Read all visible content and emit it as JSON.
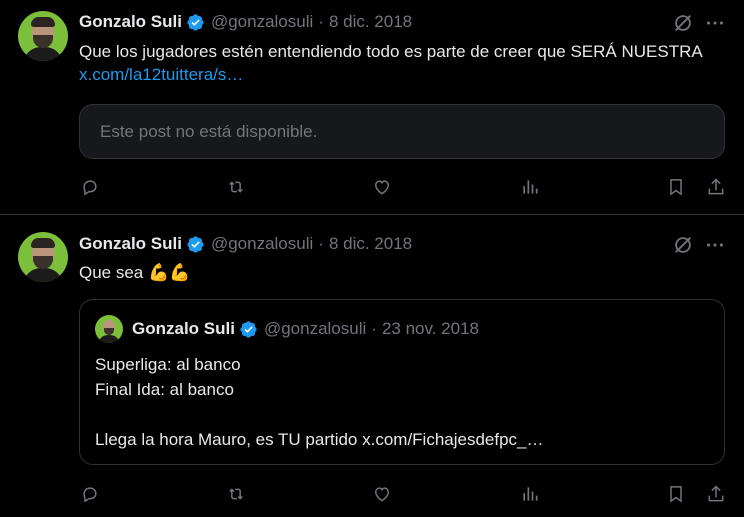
{
  "tweets": [
    {
      "author_name": "Gonzalo Suli",
      "handle": "@gonzalosuli",
      "separator": "·",
      "date": "8 dic. 2018",
      "text": "Que los jugadores estén entendiendo todo es parte de creer que SERÁ NUESTRA",
      "link": "x.com/la12tuittera/s…",
      "unavailable_text": "Este post no está disponible."
    },
    {
      "author_name": "Gonzalo Suli",
      "handle": "@gonzalosuli",
      "separator": "·",
      "date": "8 dic. 2018",
      "text": "Que sea 💪💪",
      "quote": {
        "author_name": "Gonzalo Suli",
        "handle": "@gonzalosuli",
        "separator": "·",
        "date": "23 nov. 2018",
        "lines": [
          "Superliga: al banco",
          "Final Ida: al banco",
          "",
          "Llega la hora Mauro, es TU partido x.com/Fichajesdefpc_…"
        ]
      }
    }
  ],
  "icons": {
    "verified": "verified-badge-icon",
    "grok": "grok-icon",
    "more": "more-icon",
    "reply": "reply-icon",
    "repost": "repost-icon",
    "like": "like-icon",
    "views": "views-icon",
    "bookmark": "bookmark-icon",
    "share": "share-icon"
  },
  "colors": {
    "background": "#000000",
    "text": "#e7e9ea",
    "secondary": "#71767b",
    "link": "#1d9bf0",
    "border": "#2f3336",
    "verified": "#1d9bf0",
    "avatar_bg": "#7bbf3a"
  }
}
